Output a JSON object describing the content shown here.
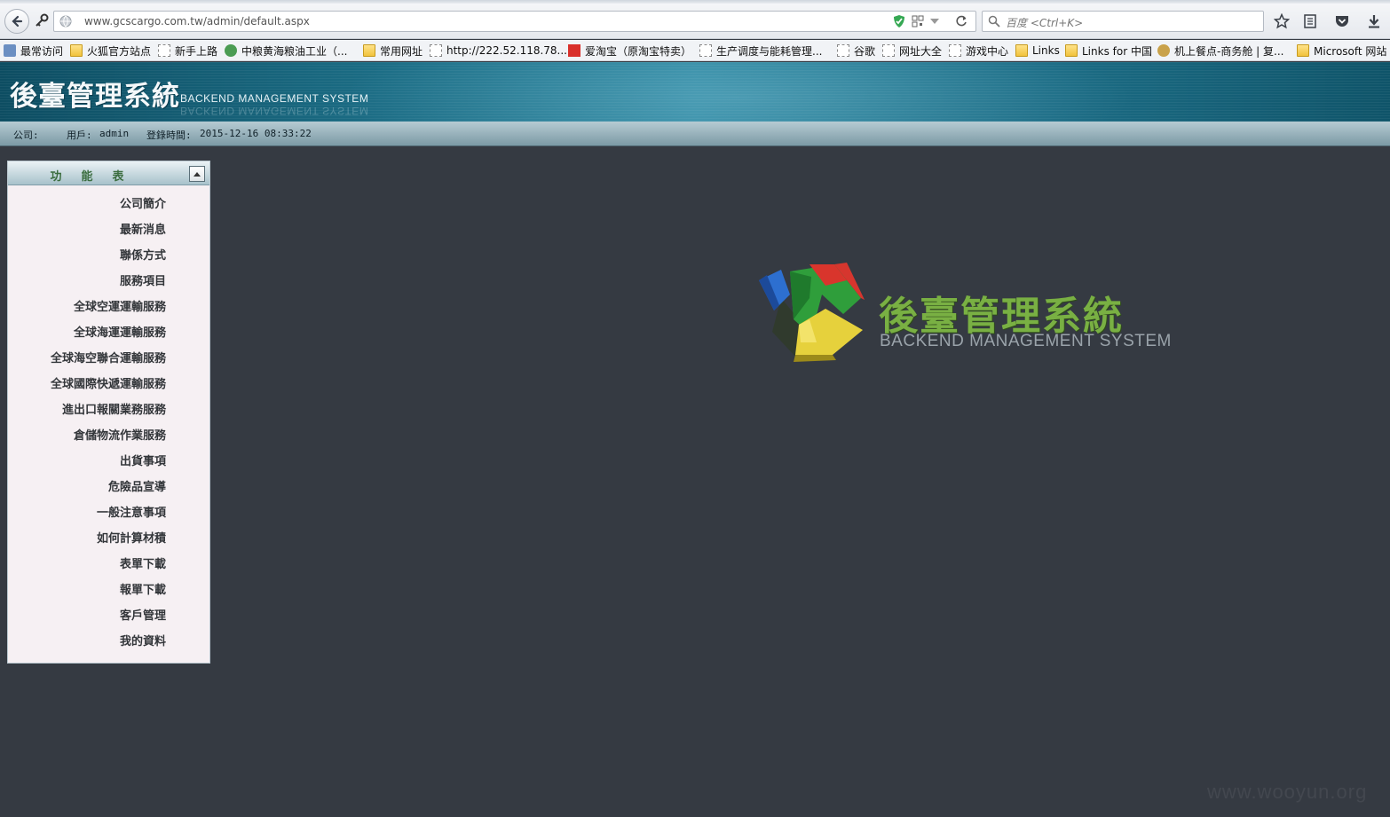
{
  "browser": {
    "url": "www.gcscargo.com.tw/admin/default.aspx",
    "search_placeholder": "百度 <Ctrl+K>"
  },
  "bookmarks": [
    {
      "label": "最常访问",
      "icon": "search-icon"
    },
    {
      "label": "火狐官方站点",
      "icon": "folder-icon"
    },
    {
      "label": "新手上路",
      "icon": "page-icon"
    },
    {
      "label": "中粮黄海粮油工业（...",
      "icon": "site-icon"
    },
    {
      "label": "常用网址",
      "icon": "folder-icon"
    },
    {
      "label": "http://222.52.118.78...",
      "icon": "page-icon"
    },
    {
      "label": "爱淘宝（原淘宝特卖）",
      "icon": "taobao-icon"
    },
    {
      "label": "生产调度与能耗管理...",
      "icon": "page-icon"
    },
    {
      "label": "谷歌",
      "icon": "page-icon"
    },
    {
      "label": "网址大全",
      "icon": "page-icon"
    },
    {
      "label": "游戏中心",
      "icon": "page-icon"
    },
    {
      "label": "Links",
      "icon": "folder-icon"
    },
    {
      "label": "Links for 中国",
      "icon": "folder-icon"
    },
    {
      "label": "机上餐点-商务舱 | 复...",
      "icon": "site-icon"
    },
    {
      "label": "Microsoft 网站",
      "icon": "folder-icon"
    }
  ],
  "banner": {
    "title": "後臺管理系統",
    "subtitle": "BACKEND  MANAGEMENT  SYSTEM"
  },
  "status": {
    "company_label": "公司:",
    "company_value": "",
    "user_label": "用戶:",
    "user_value": "admin",
    "login_label": "登錄時間:",
    "login_value": "2015-12-16 08:33:22"
  },
  "menu": {
    "title": "功能表",
    "items": [
      "公司簡介",
      "最新消息",
      "聯係方式",
      "服務項目",
      "全球空運運輸服務",
      "全球海運運輸服務",
      "全球海空聯合運輸服務",
      "全球國際快遞運輸服務",
      "進出口報關業務服務",
      "倉儲物流作業服務",
      "出貨事項",
      "危險品宣導",
      "一般注意事項",
      "如何計算材積",
      "表單下載",
      "報單下載",
      "客戶管理",
      "我的資料"
    ]
  },
  "logo": {
    "title": "後臺管理系統",
    "subtitle": "BACKEND MANAGEMENT SYSTEM"
  },
  "watermark": "www.wooyun.org",
  "colors": {
    "page_bg": "#353a42",
    "banner": "#1a6a82",
    "logo_green": "#79b043",
    "menu_bg": "#f6f0f3"
  }
}
